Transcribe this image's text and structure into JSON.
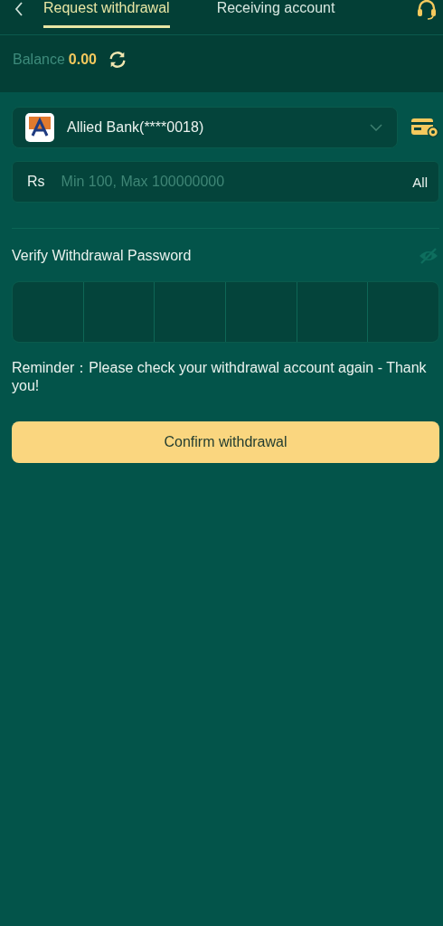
{
  "tabs": [
    {
      "label": "Request withdrawal",
      "selected": true
    },
    {
      "label": "Receiving account",
      "selected": false
    }
  ],
  "balance": {
    "label": "Balance",
    "value": "0.00"
  },
  "account": {
    "bank": "Allied Bank(****0018)"
  },
  "amount": {
    "currency": "Rs",
    "placeholder": "Min 100, Max 100000000",
    "all": "All"
  },
  "password": {
    "label": "Verify Withdrawal Password",
    "digits": [
      {
        "filled": false
      },
      {
        "filled": false
      },
      {
        "filled": false
      },
      {
        "filled": false
      },
      {
        "filled": false
      },
      {
        "filled": false
      }
    ]
  },
  "reminder": "Reminder：Please check your withdrawal account again - Thank you!",
  "confirm_button": "Confirm withdrawal"
}
